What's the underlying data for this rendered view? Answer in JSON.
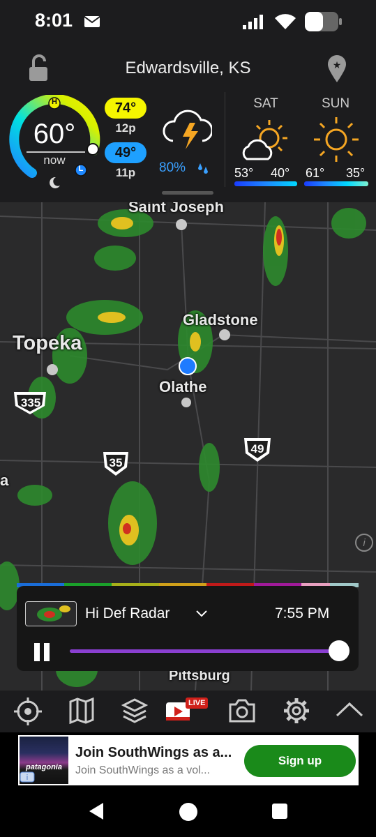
{
  "status_bar": {
    "time": "8:01"
  },
  "header": {
    "location": "Edwardsville, KS",
    "current": {
      "temp": "60°",
      "label": "now",
      "high_marker": "H",
      "low_marker": "L"
    },
    "high": {
      "temp": "74°",
      "time": "12p"
    },
    "low": {
      "temp": "49°",
      "time": "11p"
    },
    "today": {
      "precip": "80%",
      "icon": "thunderstorm-icon"
    },
    "forecast": [
      {
        "day": "SAT",
        "high": "53°",
        "low": "40°",
        "icon": "partly-cloudy-icon"
      },
      {
        "day": "SUN",
        "high": "61°",
        "low": "35°",
        "icon": "sunny-icon"
      }
    ],
    "colors": {
      "high_badge": "#f5f500",
      "low_badge": "#1ea0ff",
      "precip": "#3aa0ff",
      "sun": "#f5a623"
    }
  },
  "map": {
    "cities": [
      {
        "name": "Saint Joseph"
      },
      {
        "name": "Gladstone"
      },
      {
        "name": "Topeka"
      },
      {
        "name": "Olathe"
      },
      {
        "name": "Pittsburg"
      },
      {
        "name": "a"
      }
    ],
    "highways": [
      "335",
      "35",
      "49"
    ],
    "info_icon": "info-icon"
  },
  "player": {
    "layer": "Hi Def Radar",
    "timestamp": "7:55 PM",
    "progress": 1.0,
    "accent": "#8a3fd1"
  },
  "toolbar": {
    "items": [
      "locate-icon",
      "map-icon",
      "layers-icon",
      "video-icon",
      "camera-icon",
      "settings-icon",
      "chevron-up-icon"
    ],
    "live_badge": "LIVE"
  },
  "ad": {
    "brand": "patagonia",
    "title": "Join SouthWings as a...",
    "subtitle": "Join SouthWings as a vol...",
    "cta": "Sign up",
    "cta_color": "#1a8a1a"
  }
}
